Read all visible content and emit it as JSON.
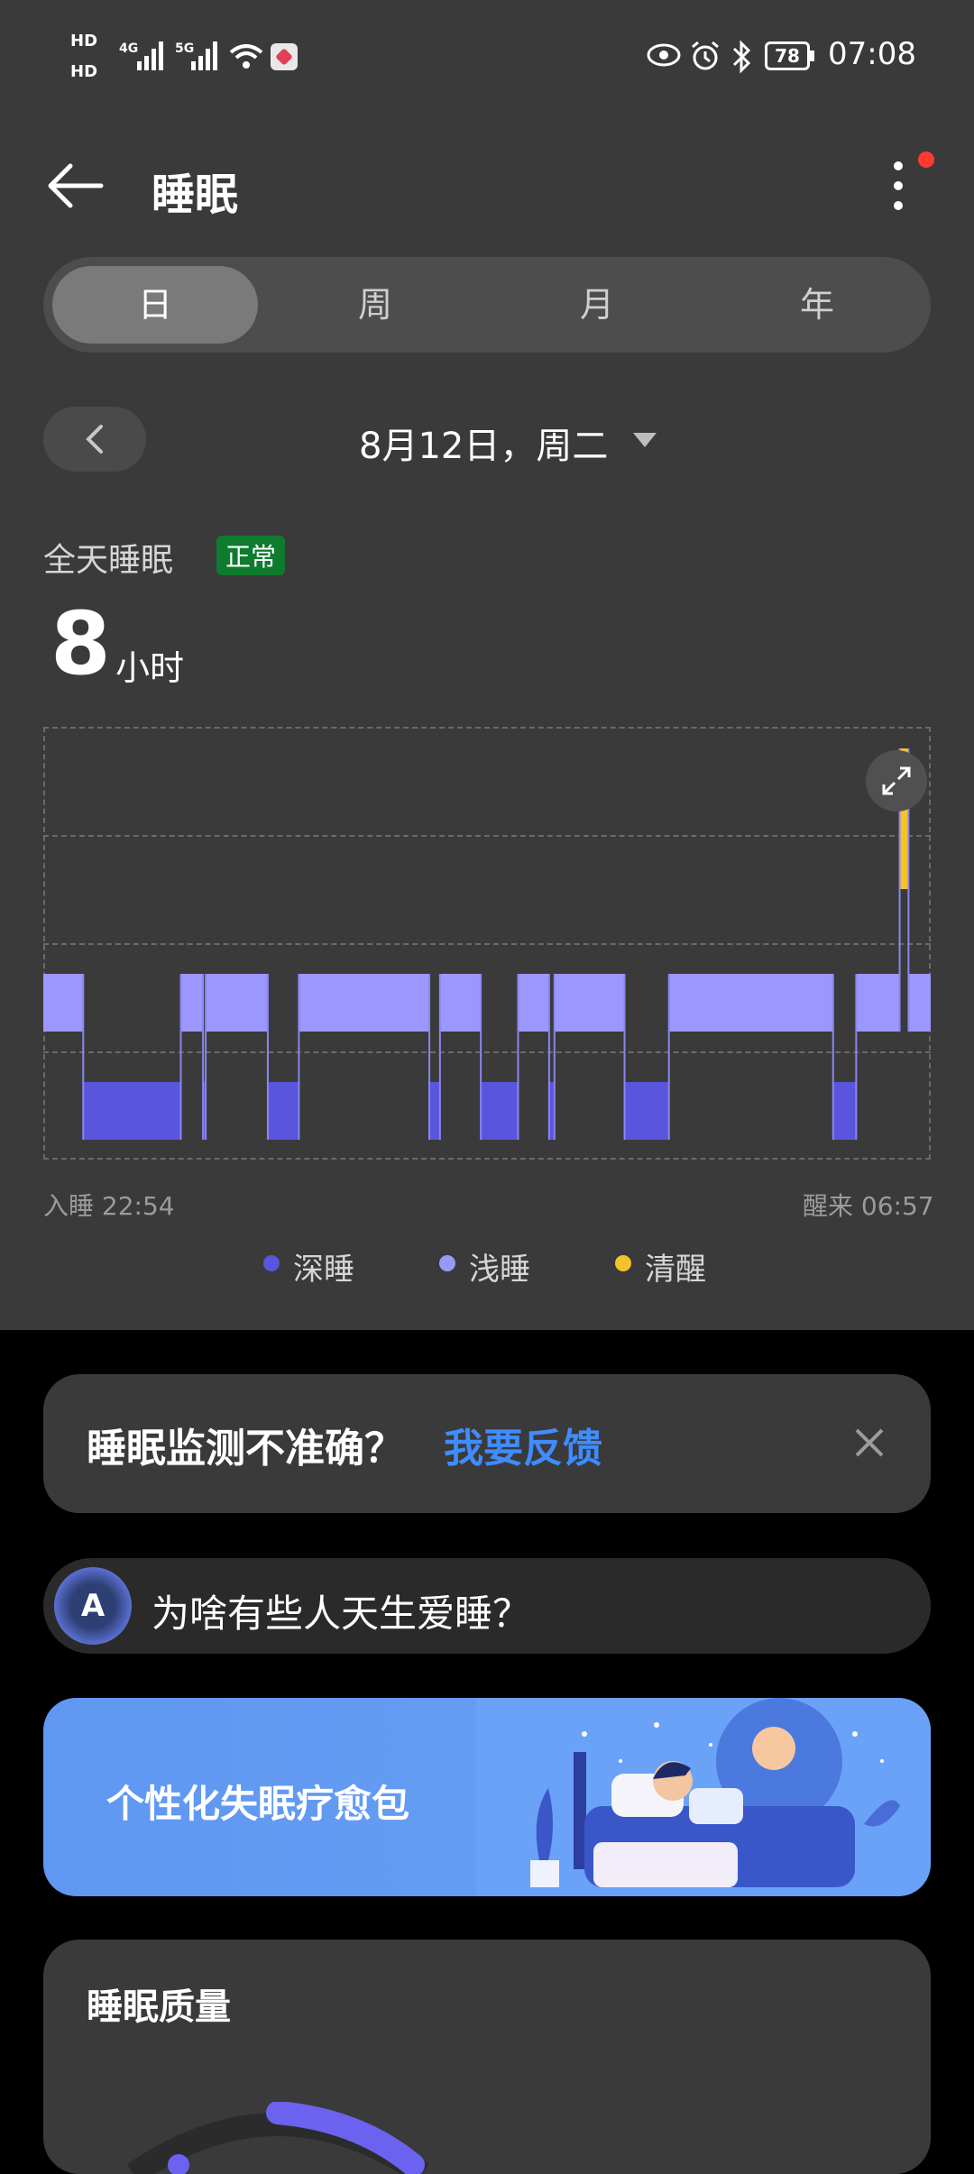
{
  "status_bar": {
    "hd1": "HD",
    "hd2": "HD",
    "net1": "4G",
    "net2": "5G",
    "battery": "78",
    "time": "07:08"
  },
  "header": {
    "title": "睡眠",
    "back_icon": "arrow-left-icon",
    "more_icon": "more-vertical-icon",
    "notification_dot_color": "#ff3b30"
  },
  "tabs": [
    {
      "label": "日",
      "active": true
    },
    {
      "label": "周",
      "active": false
    },
    {
      "label": "月",
      "active": false
    },
    {
      "label": "年",
      "active": false
    }
  ],
  "date_nav": {
    "date_label": "8月12日，周二",
    "prev_icon": "chevron-left-icon",
    "dropdown_icon": "triangle-down-icon"
  },
  "summary": {
    "label": "全天睡眠",
    "badge": "正常",
    "hours": "8",
    "unit": "小时"
  },
  "chart_data": {
    "type": "bar",
    "title": "",
    "stage_colors": {
      "deep": "#5a55dd",
      "light": "#9b97ff",
      "awake": "#f6c22b"
    },
    "segments": [
      {
        "stage": "light",
        "start": 0.0,
        "end": 0.045
      },
      {
        "stage": "deep",
        "start": 0.045,
        "end": 0.155
      },
      {
        "stage": "light",
        "start": 0.155,
        "end": 0.18
      },
      {
        "stage": "deep",
        "start": 0.18,
        "end": 0.183
      },
      {
        "stage": "light",
        "start": 0.183,
        "end": 0.253
      },
      {
        "stage": "deep",
        "start": 0.253,
        "end": 0.288
      },
      {
        "stage": "light",
        "start": 0.288,
        "end": 0.435
      },
      {
        "stage": "deep",
        "start": 0.435,
        "end": 0.447
      },
      {
        "stage": "light",
        "start": 0.447,
        "end": 0.493
      },
      {
        "stage": "deep",
        "start": 0.493,
        "end": 0.535
      },
      {
        "stage": "light",
        "start": 0.535,
        "end": 0.57
      },
      {
        "stage": "deep",
        "start": 0.57,
        "end": 0.576
      },
      {
        "stage": "light",
        "start": 0.576,
        "end": 0.655
      },
      {
        "stage": "deep",
        "start": 0.655,
        "end": 0.705
      },
      {
        "stage": "light",
        "start": 0.705,
        "end": 0.89
      },
      {
        "stage": "deep",
        "start": 0.89,
        "end": 0.916
      },
      {
        "stage": "light",
        "start": 0.916,
        "end": 0.965
      },
      {
        "stage": "awake",
        "start": 0.965,
        "end": 0.975
      },
      {
        "stage": "light",
        "start": 0.975,
        "end": 1.0
      }
    ],
    "sleep_start": "入睡 22:54",
    "wake_time": "醒来 06:57",
    "legend": [
      "深睡",
      "浅睡",
      "清醒"
    ]
  },
  "feedback": {
    "question": "睡眠监测不准确？",
    "link": "我要反馈",
    "close_icon": "close-icon"
  },
  "ai_suggest": {
    "icon": "ai-assistant-icon",
    "text": "为啥有些人天生爱睡？"
  },
  "banner": {
    "title": "个性化失眠疗愈包"
  },
  "quality": {
    "title": "睡眠质量"
  }
}
